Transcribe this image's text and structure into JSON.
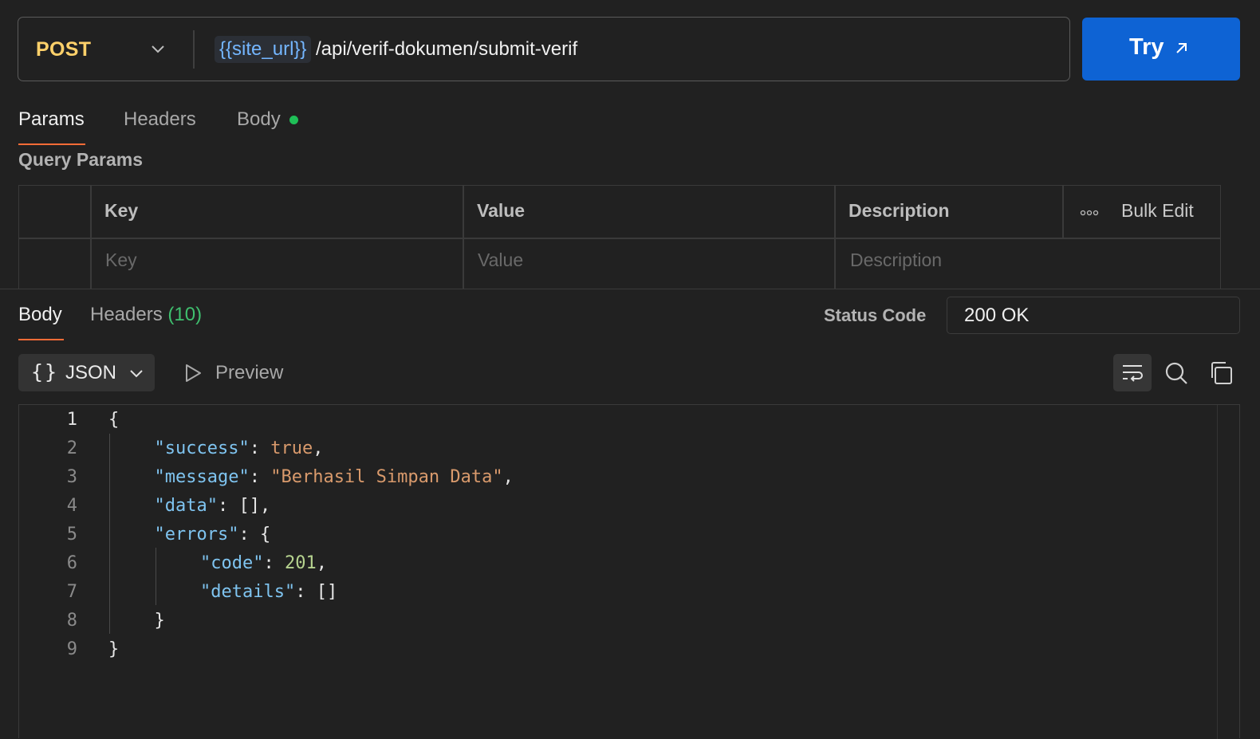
{
  "request": {
    "method": "POST",
    "url_variable": "{{site_url}}",
    "url_path": "/api/verif-dokumen/submit-verif",
    "send_button": "Try"
  },
  "request_tabs": [
    {
      "label": "Params",
      "active": true
    },
    {
      "label": "Headers",
      "active": false
    },
    {
      "label": "Body",
      "active": false,
      "has_content_dot": true
    }
  ],
  "query_params": {
    "title": "Query Params",
    "columns": [
      "Key",
      "Value",
      "Description"
    ],
    "bulk_edit": "Bulk Edit",
    "placeholders": {
      "key": "Key",
      "value": "Value",
      "description": "Description"
    }
  },
  "response": {
    "tabs": {
      "body": "Body",
      "headers": "Headers",
      "headers_count": "(10)"
    },
    "status_label": "Status Code",
    "status_value": "200 OK",
    "format_braces": "{}",
    "format": "JSON",
    "preview": "Preview",
    "body_lines": [
      {
        "n": "1",
        "indent": 0,
        "tokens": [
          {
            "t": "{",
            "k": "p"
          }
        ]
      },
      {
        "n": "2",
        "indent": 1,
        "tokens": [
          {
            "t": "\"success\"",
            "k": "key"
          },
          {
            "t": ": ",
            "k": "p"
          },
          {
            "t": "true",
            "k": "bool"
          },
          {
            "t": ",",
            "k": "p"
          }
        ]
      },
      {
        "n": "3",
        "indent": 1,
        "tokens": [
          {
            "t": "\"message\"",
            "k": "key"
          },
          {
            "t": ": ",
            "k": "p"
          },
          {
            "t": "\"Berhasil Simpan Data\"",
            "k": "str"
          },
          {
            "t": ",",
            "k": "p"
          }
        ]
      },
      {
        "n": "4",
        "indent": 1,
        "tokens": [
          {
            "t": "\"data\"",
            "k": "key"
          },
          {
            "t": ": [],",
            "k": "p"
          }
        ]
      },
      {
        "n": "5",
        "indent": 1,
        "tokens": [
          {
            "t": "\"errors\"",
            "k": "key"
          },
          {
            "t": ": {",
            "k": "p"
          }
        ]
      },
      {
        "n": "6",
        "indent": 2,
        "tokens": [
          {
            "t": "\"code\"",
            "k": "key"
          },
          {
            "t": ": ",
            "k": "p"
          },
          {
            "t": "201",
            "k": "num"
          },
          {
            "t": ",",
            "k": "p"
          }
        ]
      },
      {
        "n": "7",
        "indent": 2,
        "tokens": [
          {
            "t": "\"details\"",
            "k": "key"
          },
          {
            "t": ": []",
            "k": "p"
          }
        ]
      },
      {
        "n": "8",
        "indent": 1,
        "tokens": [
          {
            "t": "}",
            "k": "p"
          }
        ]
      },
      {
        "n": "9",
        "indent": 0,
        "tokens": [
          {
            "t": "}",
            "k": "p"
          }
        ]
      }
    ]
  },
  "colors": {
    "method": "#ffd16a",
    "send_button": "#0e63d4",
    "active_tab_underline": "#ff6c37",
    "body_dot": "#1fbf57",
    "url_variable": "#74b6ff"
  },
  "icons": {
    "method_dropdown": "chevron-down-icon",
    "send": "arrow-up-right-icon",
    "more": "more-horizontal-icon",
    "format_dropdown": "chevron-down-icon",
    "preview": "play-icon",
    "wrap": "wrap-lines-icon",
    "search": "search-icon",
    "copy": "copy-icon"
  }
}
